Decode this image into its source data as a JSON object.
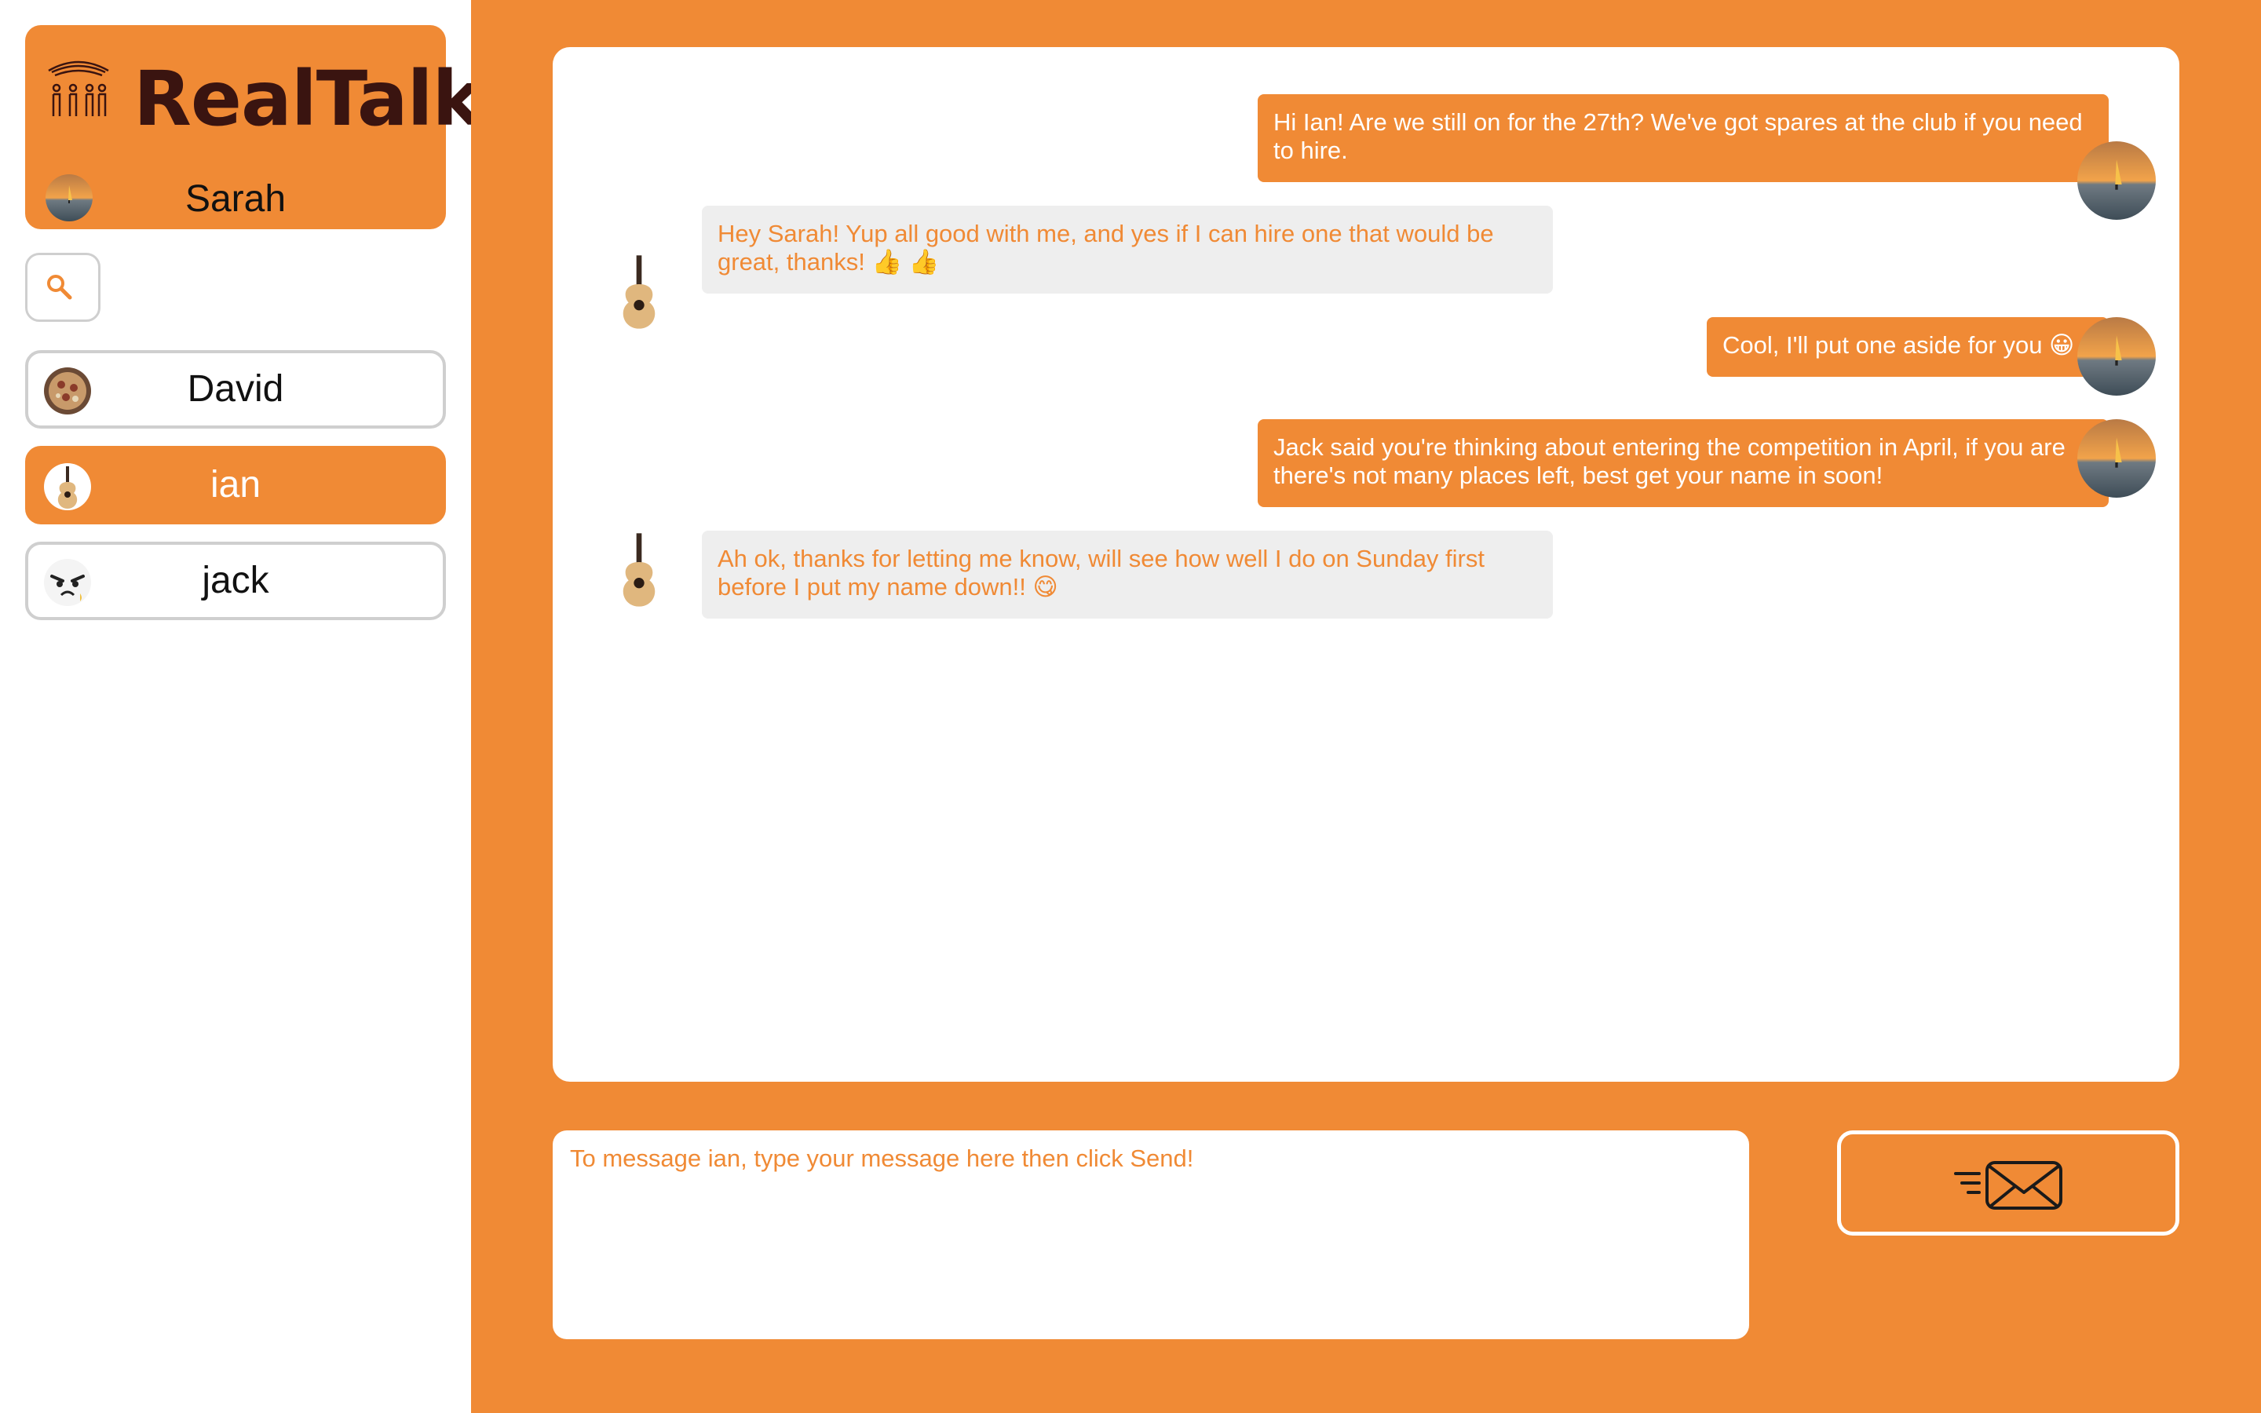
{
  "app": {
    "name": "RealTalk"
  },
  "current_user": {
    "name": "Sarah"
  },
  "colors": {
    "accent": "#F08A35",
    "incoming_bubble": "#eeeeee",
    "brand_text": "#3a1410"
  },
  "sidebar": {
    "search_icon": "search-icon",
    "contacts": [
      {
        "name": "David",
        "active": false,
        "avatar": "pizza-photo"
      },
      {
        "name": "ian",
        "active": true,
        "avatar": "guitar-photo"
      },
      {
        "name": "jack",
        "active": false,
        "avatar": "cartoon-face"
      }
    ]
  },
  "conversation": {
    "with": "ian",
    "messages": [
      {
        "direction": "out",
        "text": "Hi Ian! Are we still on for the 27th? We've got spares at the club if you need to hire."
      },
      {
        "direction": "in",
        "text": "Hey Sarah! Yup all good with me, and yes if I can hire one that would be great, thanks! 👍 👍"
      },
      {
        "direction": "out",
        "text": "Cool, I'll put one aside for you 😀"
      },
      {
        "direction": "out",
        "text": "Jack said you're thinking about entering the competition in April, if you are there's not many places left, best get your name in soon!"
      },
      {
        "direction": "in",
        "text": "Ah ok, thanks for letting me know, will see how well I do on Sunday first before I put my name down!! 😋"
      }
    ]
  },
  "composer": {
    "placeholder": "To message ian, type your message here then click Send!",
    "send_icon": "send-mail-icon"
  }
}
